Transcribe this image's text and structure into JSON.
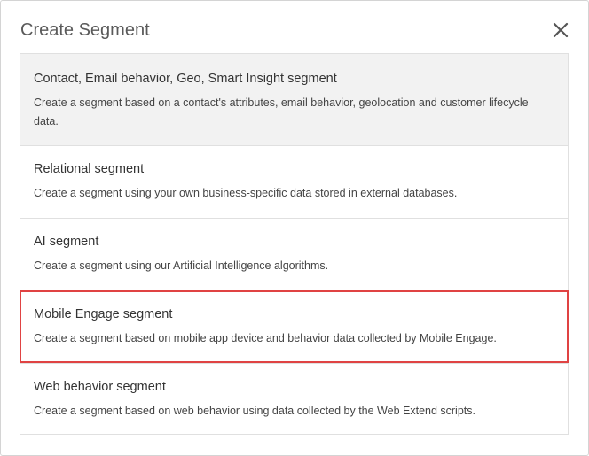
{
  "dialog": {
    "title": "Create Segment",
    "close_icon": "close-icon"
  },
  "segments": [
    {
      "title": "Contact, Email behavior, Geo, Smart Insight segment",
      "description": "Create a segment based on a contact's attributes, email behavior, geolocation and customer lifecycle data.",
      "active": true
    },
    {
      "title": "Relational segment",
      "description": "Create a segment using your own business-specific data stored in external databases.",
      "active": false
    },
    {
      "title": "AI segment",
      "description": "Create a segment using our Artificial Intelligence algorithms.",
      "active": false
    },
    {
      "title": "Mobile Engage segment",
      "description": "Create a segment based on mobile app device and behavior data collected by Mobile Engage.",
      "active": false,
      "highlighted": true
    },
    {
      "title": "Web behavior segment",
      "description": "Create a segment based on web behavior using data collected by the Web Extend scripts.",
      "active": false
    }
  ],
  "colors": {
    "highlight_border": "#e04343",
    "active_background": "#f2f2f2",
    "divider": "#e0e0e0"
  }
}
